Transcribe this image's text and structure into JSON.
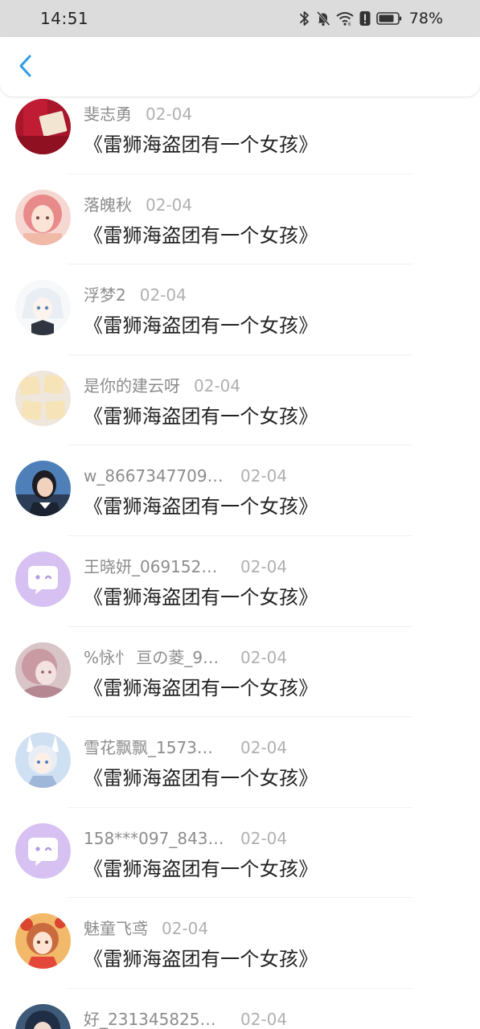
{
  "status_bar": {
    "time": "14:51",
    "battery_percent": "78%",
    "icons": [
      "bluetooth-icon",
      "bell-muted-icon",
      "wifi-icon",
      "alert-icon",
      "battery-icon"
    ]
  },
  "header": {
    "back_icon": "chevron-left-icon",
    "accent_color": "#2f9be8"
  },
  "comments": [
    {
      "user": "斐志勇",
      "date": "02-04",
      "text": "《雷狮海盗团有一个女孩》",
      "avatar": "red-envelope-photo",
      "truncated": false
    },
    {
      "user": "落魄秋",
      "date": "02-04",
      "text": "《雷狮海盗团有一个女孩》",
      "avatar": "pink-hair-girl",
      "truncated": false
    },
    {
      "user": "浮梦2",
      "date": "02-04",
      "text": "《雷狮海盗团有一个女孩》",
      "avatar": "white-hair-anime",
      "truncated": false
    },
    {
      "user": "是你的建云呀",
      "date": "02-04",
      "text": "《雷狮海盗团有一个女孩》",
      "avatar": "biscuits-photo",
      "truncated": false
    },
    {
      "user": "w_8667347709…",
      "date": "02-04",
      "text": "《雷狮海盗团有一个女孩》",
      "avatar": "girl-photo",
      "truncated": true
    },
    {
      "user": "王晓妍_069152…",
      "date": "02-04",
      "text": "《雷狮海盗团有一个女孩》",
      "avatar": "default-chat-avatar",
      "truncated": true
    },
    {
      "user": "%怺忄 亘の菱_9…",
      "date": "02-04",
      "text": "《雷狮海盗团有一个女孩》",
      "avatar": "pink-anime-girl",
      "truncated": true
    },
    {
      "user": "雪花飘飘_1573…",
      "date": "02-04",
      "text": "《雷狮海盗团有一个女孩》",
      "avatar": "bunny-anime-girl",
      "truncated": true
    },
    {
      "user": "158***097_843…",
      "date": "02-04",
      "text": "《雷狮海盗团有一个女孩》",
      "avatar": "default-chat-avatar",
      "truncated": true
    },
    {
      "user": "魅童飞鸢",
      "date": "02-04",
      "text": "《雷狮海盗团有一个女孩》",
      "avatar": "festive-anime-girl",
      "truncated": false
    },
    {
      "user": "好_231345825…",
      "date": "02-04",
      "text": "",
      "avatar": "blue-anime-boy",
      "truncated": true
    }
  ],
  "colors": {
    "status_bar_bg": "#dcdcdc",
    "default_avatar_bg": "#d6c1f2",
    "meta_text": "#9b9b9b",
    "comment_text": "#222222"
  }
}
